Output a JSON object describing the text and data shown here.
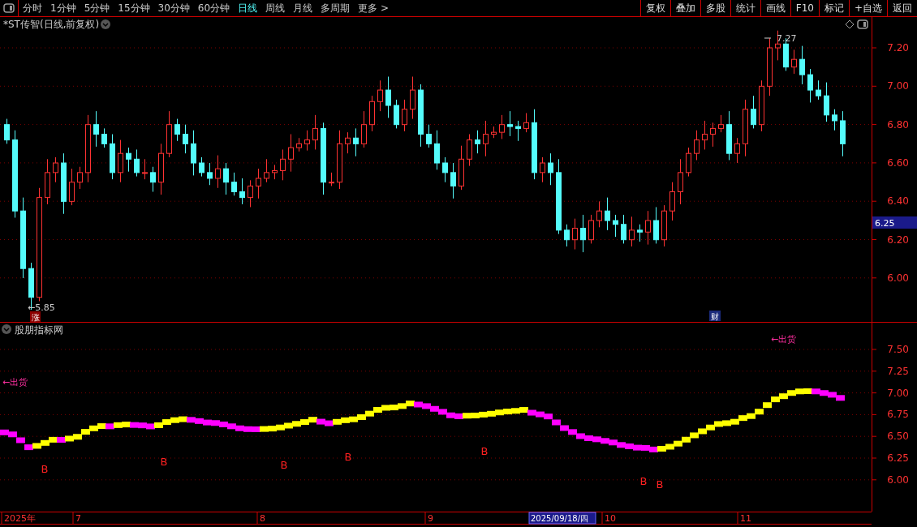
{
  "toolbar": {
    "periods": [
      {
        "label": "分时",
        "selected": false
      },
      {
        "label": "1分钟",
        "selected": false
      },
      {
        "label": "5分钟",
        "selected": false
      },
      {
        "label": "15分钟",
        "selected": false
      },
      {
        "label": "30分钟",
        "selected": false
      },
      {
        "label": "60分钟",
        "selected": false
      },
      {
        "label": "日线",
        "selected": true
      },
      {
        "label": "周线",
        "selected": false
      },
      {
        "label": "月线",
        "selected": false
      },
      {
        "label": "多周期",
        "selected": false
      },
      {
        "label": "更多 >",
        "selected": false
      }
    ],
    "buttons": [
      "复权",
      "叠加",
      "多股",
      "统计",
      "画线",
      "F10",
      "标记",
      "+自选",
      "返回"
    ]
  },
  "main_chart": {
    "title": "*ST传智(日线,前复权)",
    "y_ticks": [
      "7.20",
      "7.00",
      "6.80",
      "6.60",
      "6.40",
      "6.20",
      "6.00"
    ],
    "high_label": "7.27",
    "low_label": "←5.85",
    "badges": [
      "涨",
      "财"
    ],
    "cursor_price": "6.25"
  },
  "indicator": {
    "title": "股朋指标网",
    "y_ticks": [
      "7.50",
      "7.25",
      "7.00",
      "6.75",
      "6.50",
      "6.25",
      "6.00"
    ],
    "signals": [
      "←出货",
      "←出货"
    ],
    "markers": [
      "B",
      "B",
      "B",
      "B",
      "B",
      "B",
      "B"
    ]
  },
  "date_axis": {
    "labels": [
      "2025年",
      "7",
      "8",
      "9",
      "10",
      "11"
    ],
    "cursor_date": "2025/09/18/四"
  }
}
